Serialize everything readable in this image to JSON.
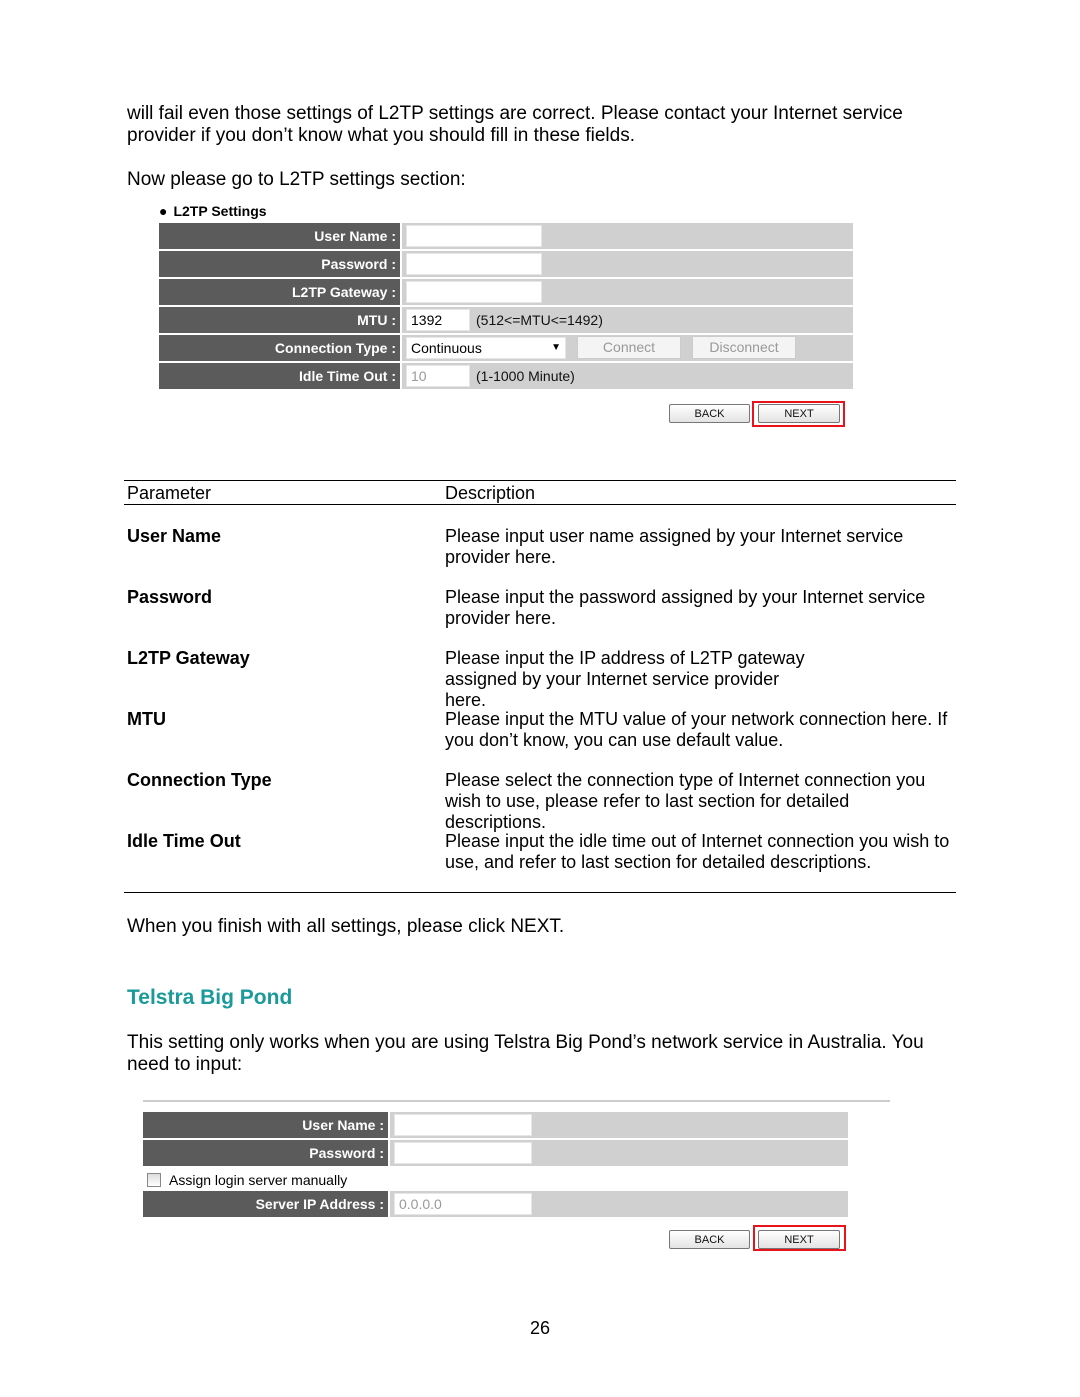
{
  "intro_text": "will fail even those settings of L2TP settings are correct. Please contact your Internet service provider if you don’t know what you should fill in these fields.",
  "goto_text": "Now please go to L2TP settings section:",
  "l2tp_panel": {
    "title": "L2TP Settings",
    "rows": [
      {
        "label": "User Name :",
        "value": ""
      },
      {
        "label": "Password :",
        "value": ""
      },
      {
        "label": "L2TP Gateway :",
        "value": ""
      },
      {
        "label": "MTU :",
        "value": "1392",
        "hint": "(512<=MTU<=1492)"
      },
      {
        "label": "Connection Type :",
        "value": "Continuous",
        "connect": "Connect",
        "disconnect": "Disconnect"
      },
      {
        "label": "Idle Time Out :",
        "value": "10",
        "hint": "(1-1000 Minute)"
      }
    ],
    "back": "BACK",
    "next": "NEXT"
  },
  "param_table": {
    "headers": [
      "Parameter",
      "Description"
    ],
    "rows": [
      {
        "param": "User Name",
        "desc": "Please input user name assigned by your Internet service provider here."
      },
      {
        "param": "Password",
        "desc": "Please input the password assigned by your Internet service provider here."
      },
      {
        "param": "L2TP Gateway",
        "desc": "Please input the IP address of L2TP gateway assigned by your Internet service provider here."
      },
      {
        "param": "MTU",
        "desc": "Please input the MTU value of your network connection here. If you don’t know, you can use default value."
      },
      {
        "param": "Connection Type",
        "desc": "Please select the connection type of Internet connection you wish to use, please refer to last section for detailed descriptions."
      },
      {
        "param": "Idle Time Out",
        "desc": "Please input the idle time out of Internet connection you wish to use, and refer to last section for detailed descriptions."
      }
    ]
  },
  "finish_text": "When you finish with all settings, please click NEXT.",
  "section_heading": "Telstra Big Pond",
  "section_heading_color": "#1a9a9a",
  "bigpond_text": "This setting only works when you are using Telstra Big Pond’s network service in Australia. You need to input:",
  "bigpond_panel": {
    "username_label": "User Name :",
    "password_label": "Password :",
    "checkbox_label": "Assign login server manually",
    "checkbox_checked": false,
    "server_label": "Server IP Address :",
    "server_value": "0.0.0.0",
    "back": "BACK",
    "next": "NEXT"
  },
  "page_number": "26"
}
